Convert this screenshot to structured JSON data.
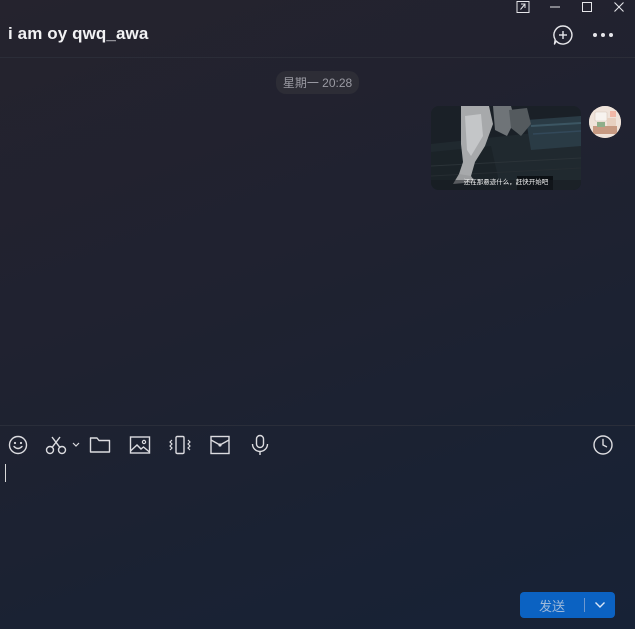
{
  "window": {
    "controls": [
      "pin-icon",
      "minimize-icon",
      "maximize-icon",
      "close-icon"
    ]
  },
  "header": {
    "title": "i am oy qwq_awa",
    "icons": [
      "add-chat-icon",
      "more-icon"
    ]
  },
  "messages": {
    "timestamp": "星期一 20:28",
    "items": [
      {
        "type": "image",
        "caption": "还在那悬迹什么，赶快开始吧"
      }
    ]
  },
  "composer": {
    "tools": [
      "emoji-icon",
      "scissors-icon",
      "folder-icon",
      "image-icon",
      "shake-icon",
      "red-packet-icon",
      "microphone-icon",
      "history-clock-icon"
    ],
    "input_value": "",
    "send_label": "发送"
  },
  "colors": {
    "accent": "#0b62c2",
    "timestamp_bg": "#2d2d36",
    "title_text": "#f2f2f4"
  }
}
